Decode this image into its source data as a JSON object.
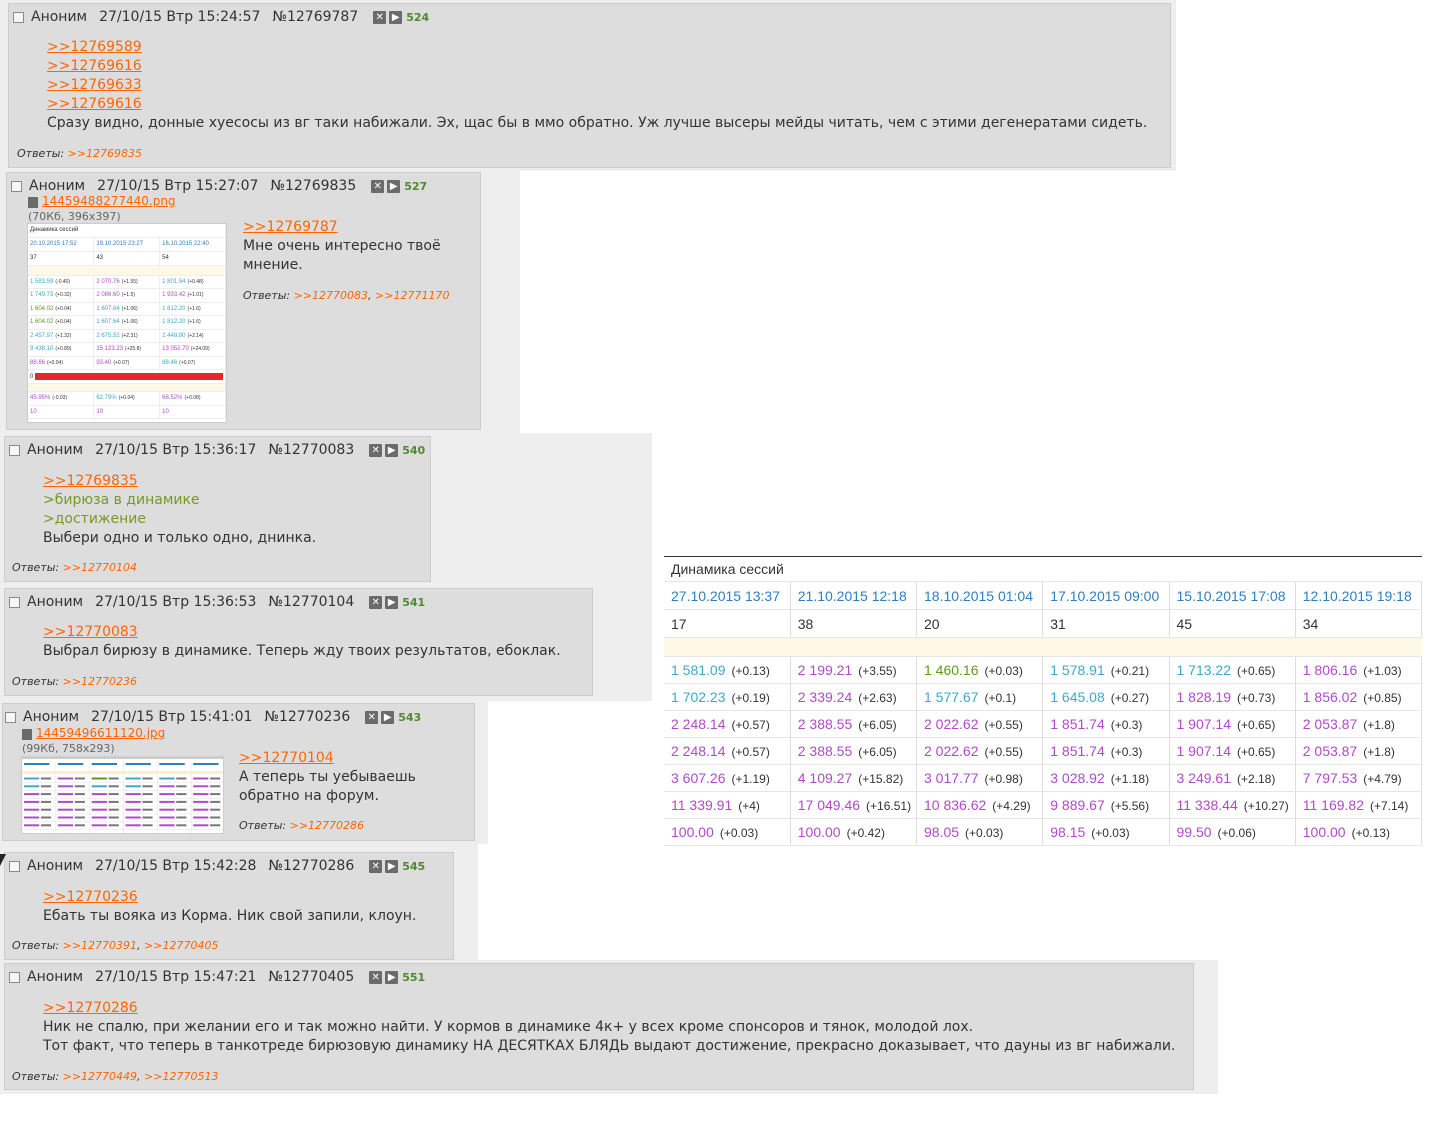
{
  "colors": {
    "cyan": "#3ea9c9",
    "magenta": "#b04bc8",
    "green": "#5a9a1c",
    "blue": "#2f7fc1",
    "link": "#ff6600",
    "quote": "#789922",
    "red": "#e8262d"
  },
  "posts": [
    {
      "name": "Аноним",
      "date": "27/10/15 Втр 15:24:57",
      "num": "№12769787",
      "count": "524",
      "refs": [
        ">>12769589",
        ">>12769616",
        ">>12769633",
        ">>12769616"
      ],
      "text": [
        "Сразу видно, донные хуесосы из вг таки набижали. Эх, щас бы в ммо обратно. Уж лучше высеры мейды читать, чем с этими дегенератами сидеть."
      ],
      "answers_label": "Ответы:",
      "answers": [
        ">>12769835"
      ]
    },
    {
      "name": "Аноним",
      "date": "27/10/15 Втр 15:27:07",
      "num": "№12769835",
      "count": "527",
      "file_name": "14459488277440.png",
      "file_info": "(70Кб, 396x397)",
      "refs": [
        ">>12769787"
      ],
      "text": [
        "Мне очень интересно твоё",
        "мнение."
      ],
      "answers_label": "Ответы:",
      "answers": [
        ">>12770083",
        ">>12771170"
      ]
    },
    {
      "name": "Аноним",
      "date": "27/10/15 Втр 15:36:17",
      "num": "№12770083",
      "count": "540",
      "refs": [
        ">>12769835"
      ],
      "quotes": [
        ">бирюза в динамике",
        ">достижение"
      ],
      "text": [
        "Выбери одно и только одно, днинка."
      ],
      "answers_label": "Ответы:",
      "answers": [
        ">>12770104"
      ]
    },
    {
      "name": "Аноним",
      "date": "27/10/15 Втр 15:36:53",
      "num": "№12770104",
      "count": "541",
      "refs": [
        ">>12770083"
      ],
      "text": [
        "Выбрал бирюзу в динамике. Теперь жду твоих результатов, ебоклак."
      ],
      "answers_label": "Ответы:",
      "answers": [
        ">>12770236"
      ]
    },
    {
      "name": "Аноним",
      "date": "27/10/15 Втр 15:41:01",
      "num": "№12770236",
      "count": "543",
      "file_name": "14459496611120.jpg",
      "file_info": "(99Кб, 758x293)",
      "refs": [
        ">>12770104"
      ],
      "text": [
        "А теперь ты уебываешь",
        "обратно на форум."
      ],
      "answers_label": "Ответы:",
      "answers": [
        ">>12770286"
      ]
    },
    {
      "name": "Аноним",
      "date": "27/10/15 Втр 15:42:28",
      "num": "№12770286",
      "count": "545",
      "refs": [
        ">>12770236"
      ],
      "text": [
        "Ебать ты вояка из Корма. Ник свой запили, клоун."
      ],
      "answers_label": "Ответы:",
      "answers": [
        ">>12770391",
        ">>12770405"
      ]
    },
    {
      "name": "Аноним",
      "date": "27/10/15 Втр 15:47:21",
      "num": "№12770405",
      "count": "551",
      "refs": [
        ">>12770286"
      ],
      "text": [
        "Ник не спалю, при желании его и так можно найти. У кормов в динамике 4к+ у всех кроме спонсоров и тянок, молодой лох.",
        "Тот факт, что теперь в танкотреде бирюзовую динамику НА ДЕСЯТКАХ БЛЯДЬ выдают достижение, прекрасно доказывает, что дауны из вг набижали."
      ],
      "answers_label": "Ответы:",
      "answers": [
        ">>12770449",
        ">>12770513"
      ]
    }
  ],
  "dynamics_table": {
    "title": "Динамика сессий",
    "dates": [
      "27.10.2015 13:37",
      "21.10.2015 12:18",
      "18.10.2015 01:04",
      "17.10.2015 09:00",
      "15.10.2015 17:08",
      "12.10.2015 19:18"
    ],
    "counts": [
      "17",
      "38",
      "20",
      "31",
      "45",
      "34"
    ],
    "rows": [
      [
        [
          "1 581.09",
          "(+0.13)",
          "cyan"
        ],
        [
          "2 199.21",
          "(+3.55)",
          "magenta"
        ],
        [
          "1 460.16",
          "(+0.03)",
          "green"
        ],
        [
          "1 578.91",
          "(+0.21)",
          "cyan"
        ],
        [
          "1 713.22",
          "(+0.65)",
          "cyan"
        ],
        [
          "1 806.16",
          "(+1.03)",
          "magenta"
        ]
      ],
      [
        [
          "1 702.23",
          "(+0.19)",
          "cyan"
        ],
        [
          "2 339.24",
          "(+2.63)",
          "magenta"
        ],
        [
          "1 577.67",
          "(+0.1)",
          "cyan"
        ],
        [
          "1 645.08",
          "(+0.27)",
          "cyan"
        ],
        [
          "1 828.19",
          "(+0.73)",
          "magenta"
        ],
        [
          "1 856.02",
          "(+0.85)",
          "magenta"
        ]
      ],
      [
        [
          "2 248.14",
          "(+0.57)",
          "magenta"
        ],
        [
          "2 388.55",
          "(+6.05)",
          "magenta"
        ],
        [
          "2 022.62",
          "(+0.55)",
          "magenta"
        ],
        [
          "1 851.74",
          "(+0.3)",
          "magenta"
        ],
        [
          "1 907.14",
          "(+0.65)",
          "magenta"
        ],
        [
          "2 053.87",
          "(+1.8)",
          "magenta"
        ]
      ],
      [
        [
          "2 248.14",
          "(+0.57)",
          "magenta"
        ],
        [
          "2 388.55",
          "(+6.05)",
          "magenta"
        ],
        [
          "2 022.62",
          "(+0.55)",
          "magenta"
        ],
        [
          "1 851.74",
          "(+0.3)",
          "magenta"
        ],
        [
          "1 907.14",
          "(+0.65)",
          "magenta"
        ],
        [
          "2 053.87",
          "(+1.8)",
          "magenta"
        ]
      ],
      [
        [
          "3 607.26",
          "(+1.19)",
          "magenta"
        ],
        [
          "4 109.27",
          "(+15.82)",
          "magenta"
        ],
        [
          "3 017.77",
          "(+0.98)",
          "magenta"
        ],
        [
          "3 028.92",
          "(+1.18)",
          "magenta"
        ],
        [
          "3 249.61",
          "(+2.18)",
          "magenta"
        ],
        [
          "7 797.53",
          "(+4.79)",
          "magenta"
        ]
      ],
      [
        [
          "11 339.91",
          "(+4)",
          "magenta"
        ],
        [
          "17 049.46",
          "(+16.51)",
          "magenta"
        ],
        [
          "10 836.62",
          "(+4.29)",
          "magenta"
        ],
        [
          "9 889.67",
          "(+5.56)",
          "magenta"
        ],
        [
          "11 338.44",
          "(+10.27)",
          "magenta"
        ],
        [
          "11 169.82",
          "(+7.14)",
          "magenta"
        ]
      ],
      [
        [
          "100.00",
          "(+0.03)",
          "magenta"
        ],
        [
          "100.00",
          "(+0.42)",
          "magenta"
        ],
        [
          "98.05",
          "(+0.03)",
          "magenta"
        ],
        [
          "98.15",
          "(+0.03)",
          "magenta"
        ],
        [
          "99.50",
          "(+0.06)",
          "magenta"
        ],
        [
          "100.00",
          "(+0.13)",
          "magenta"
        ]
      ]
    ]
  },
  "thumb1": {
    "title": "Динамика сессий",
    "dates": [
      "20.10.2015 17:52",
      "19.10.2015 23:27",
      "16.10.2015 22:40"
    ],
    "counts": [
      "37",
      "43",
      "54"
    ],
    "rows": [
      [
        [
          "1 583.59",
          "(-0.40)",
          "cyan"
        ],
        [
          "2 070.76",
          "(+1.55)",
          "magenta"
        ],
        [
          "1 801.54",
          "(+0.48)",
          "cyan"
        ]
      ],
      [
        [
          "1 749.73",
          "(+0.32)",
          "cyan"
        ],
        [
          "2 086.60",
          "(+1.5)",
          "magenta"
        ],
        [
          "1 933.42",
          "(+1.01)",
          "magenta"
        ]
      ],
      [
        [
          "1 604.02",
          "(+0.04)",
          "green"
        ],
        [
          "1 607.64",
          "(+1.06)",
          "cyan"
        ],
        [
          "1 812.20",
          "(+1.6)",
          "cyan"
        ]
      ],
      [
        [
          "1 604.02",
          "(+0.04)",
          "green"
        ],
        [
          "1 607.64",
          "(+1.06)",
          "cyan"
        ],
        [
          "1 812.20",
          "(+1.6)",
          "cyan"
        ]
      ],
      [
        [
          "2 457.97",
          "(+1.32)",
          "cyan"
        ],
        [
          "2 675.52",
          "(+2.31)",
          "cyan"
        ],
        [
          "2 448.80",
          "(+2.14)",
          "cyan"
        ]
      ],
      [
        [
          "9 438.10",
          "(+0.89)",
          "cyan"
        ],
        [
          "15 123.23",
          "(+25.8)",
          "magenta"
        ],
        [
          "13 052.70",
          "(+24.09)",
          "magenta"
        ]
      ],
      [
        [
          "88.66",
          "(+0.04)",
          "magenta"
        ],
        [
          "93.40",
          "(+0.07)",
          "magenta"
        ],
        [
          "88.46",
          "(+0.07)",
          "cyan"
        ]
      ]
    ],
    "bar_value": "0",
    "pct": [
      [
        "45.95%",
        "(-0.03)",
        "magenta"
      ],
      [
        "62.79%",
        "(+0.04)",
        "cyan"
      ],
      [
        "68.52%",
        "(+0.08)",
        "magenta"
      ]
    ],
    "last": [
      [
        "10",
        "",
        "magenta"
      ],
      [
        "10",
        "",
        "magenta"
      ],
      [
        "10",
        "",
        "magenta"
      ]
    ]
  }
}
